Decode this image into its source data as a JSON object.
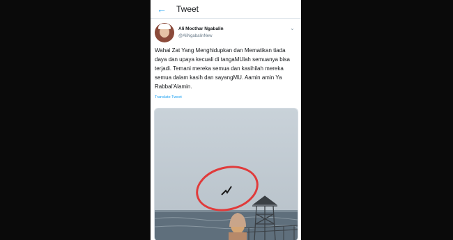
{
  "header": {
    "title": "Tweet",
    "back_icon": "arrow-left-icon"
  },
  "tweet": {
    "user_name": "Ali Mocthar Ngabalin",
    "handle": "@AliNgabalinNew",
    "menu_icon": "chevron-down-icon",
    "text": "Wahai Zat Yang Menghidupkan dan Mematikan tiada daya dan upaya kecuali di tangaMUlah semuanya bisa terjadi. Temani mereka semua dan kasihilah mereka semua dalam kasih dan sayangMU. Aamin amin Ya Rabbal'Alamin.",
    "translate_label": "Translate Tweet"
  },
  "colors": {
    "accent": "#1da1f2",
    "text": "#14171a",
    "secondary_text": "#657786",
    "circle_annotation": "#e03b3b"
  }
}
